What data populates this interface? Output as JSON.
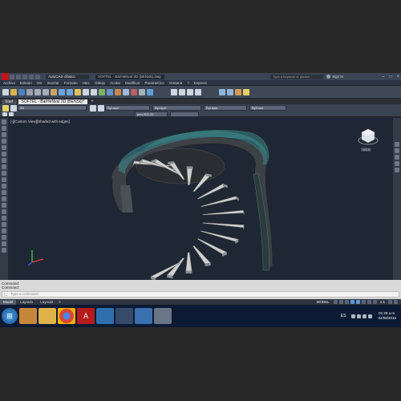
{
  "window": {
    "app_name": "AutoCAD clásico",
    "file_title": "SOFTEL - BarHeNval 3D (BENS6).dwg",
    "search_placeholder": "Type a keyword or phrase",
    "sign_in": "Sign In"
  },
  "menu": [
    "Archivo",
    "Edición",
    "Ver",
    "Insertar",
    "Formato",
    "Herr.",
    "Dibujo",
    "Acotar",
    "Modificar",
    "Parametrico",
    "Ventana",
    "?",
    "Express"
  ],
  "tabs": [
    {
      "label": "Start",
      "active": false
    },
    {
      "label": "SOFTEL - BarHeNval 3D (BENS6)*",
      "active": true
    }
  ],
  "properties": {
    "layer": "3D",
    "color": "ByLayer",
    "linetype": "ByLayer",
    "lineweight": "ByLayer",
    "plotstyle": "ByColor",
    "dimstyle": "peq.ISO-25"
  },
  "viewport": {
    "label": "[-][Custom View][Shaded with edges]",
    "viewcube_label": "WCS"
  },
  "command": {
    "history": [
      "Command:",
      "Command:"
    ],
    "placeholder": "Type a command"
  },
  "layout_tabs": [
    {
      "label": "Model",
      "active": true
    },
    {
      "label": "Layout1",
      "active": false
    },
    {
      "label": "Layout2",
      "active": false
    }
  ],
  "status": {
    "mode": "MODEL",
    "scale": "1:1"
  },
  "taskbar": {
    "lang": "ES",
    "time": "01:28 a.m.",
    "date": "04/08/2015",
    "apps": [
      "start",
      "folder",
      "explorer",
      "chrome",
      "autocad",
      "app5",
      "app6",
      "app7",
      "app8"
    ]
  },
  "colors": {
    "viewport_bg": "#1e2733",
    "railing": "#2d5b5e",
    "steps": "#cfcfcf"
  }
}
